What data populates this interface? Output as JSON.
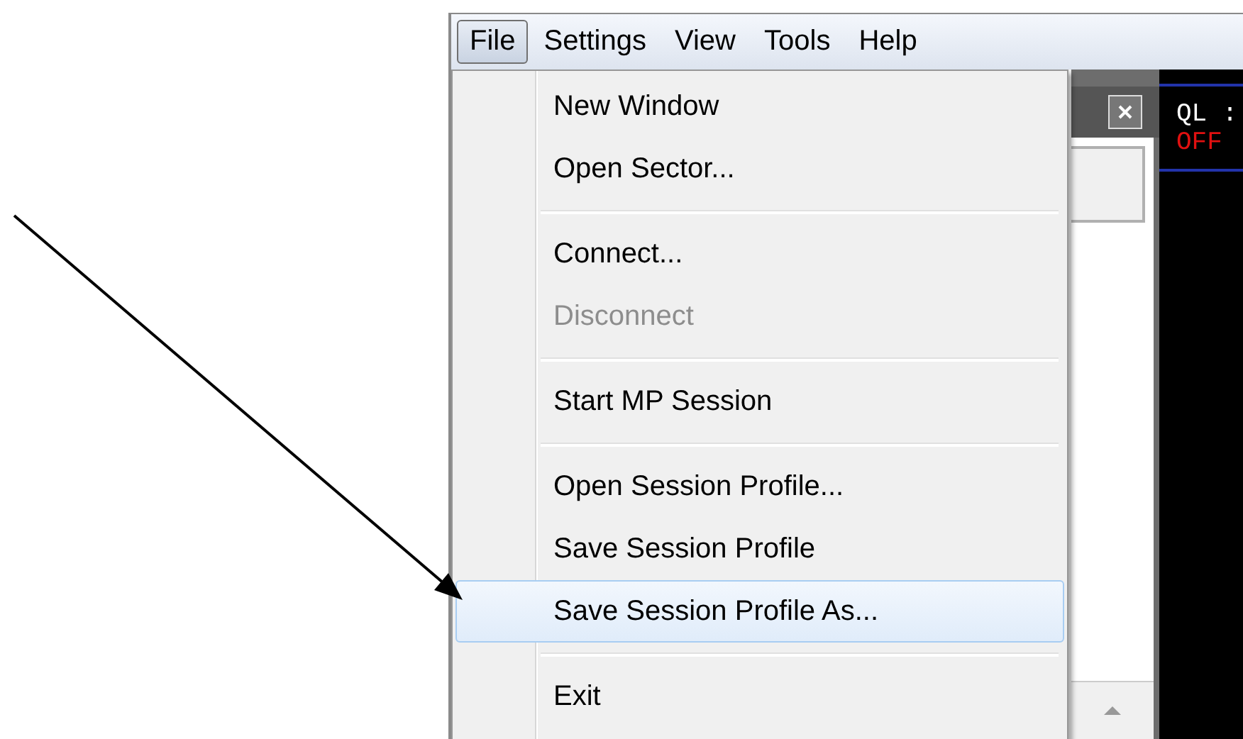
{
  "menubar": [
    {
      "label": "File",
      "selected": true
    },
    {
      "label": "Settings",
      "selected": false
    },
    {
      "label": "View",
      "selected": false
    },
    {
      "label": "Tools",
      "selected": false
    },
    {
      "label": "Help",
      "selected": false
    }
  ],
  "file_menu": [
    {
      "kind": "item",
      "label": "New Window",
      "disabled": false,
      "selected": false
    },
    {
      "kind": "item",
      "label": "Open Sector...",
      "disabled": false,
      "selected": false
    },
    {
      "kind": "separator"
    },
    {
      "kind": "item",
      "label": "Connect...",
      "disabled": false,
      "selected": false
    },
    {
      "kind": "item",
      "label": "Disconnect",
      "disabled": true,
      "selected": false
    },
    {
      "kind": "separator"
    },
    {
      "kind": "item",
      "label": "Start MP Session",
      "disabled": false,
      "selected": false
    },
    {
      "kind": "separator"
    },
    {
      "kind": "item",
      "label": "Open Session Profile...",
      "disabled": false,
      "selected": false
    },
    {
      "kind": "item",
      "label": "Save Session Profile",
      "disabled": false,
      "selected": false
    },
    {
      "kind": "item",
      "label": "Save Session Profile As...",
      "disabled": false,
      "selected": true
    },
    {
      "kind": "separator"
    },
    {
      "kind": "item",
      "label": "Exit",
      "disabled": false,
      "selected": false
    }
  ],
  "display": {
    "label": "QL :",
    "status": "OFF"
  }
}
